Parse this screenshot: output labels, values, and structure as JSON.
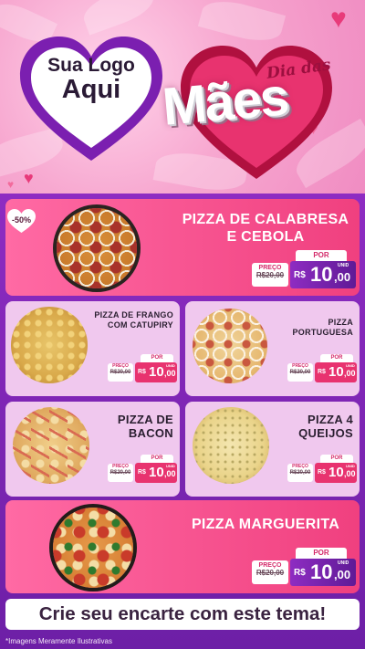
{
  "header": {
    "logo": {
      "line1": "Sua Logo",
      "line2": "Aqui"
    },
    "theme": {
      "small": "Dia das",
      "big": "Mães"
    },
    "colors": {
      "pink_bg": "#f7a8d0",
      "heart_red": "#e83a7a",
      "heart_purple": "#7b1fb0"
    }
  },
  "badge": {
    "text": "-50%",
    "icon": "heart-icon"
  },
  "products": [
    {
      "name": "PIZZA DE CALABRESA E CEBOLA",
      "price_label": "PREÇO",
      "old_price": "R$20,00",
      "por": "POR",
      "currency": "R$",
      "price_int": "10",
      "price_dec": ",00",
      "unit": "UNID"
    },
    {
      "name": "PIZZA DE FRANGO COM CATUPIRY",
      "price_label": "PREÇO",
      "old_price": "R$20,00",
      "por": "POR",
      "currency": "R$",
      "price_int": "10",
      "price_dec": ",00",
      "unit": "UNID"
    },
    {
      "name": "PIZZA PORTUGUESA",
      "price_label": "PREÇO",
      "old_price": "R$20,00",
      "por": "POR",
      "currency": "R$",
      "price_int": "10",
      "price_dec": ",00",
      "unit": "UNID"
    },
    {
      "name": "PIZZA DE BACON",
      "price_label": "PREÇO",
      "old_price": "R$20,00",
      "por": "POR",
      "currency": "R$",
      "price_int": "10",
      "price_dec": ",00",
      "unit": "UNID"
    },
    {
      "name": "PIZZA 4 QUEIJOS",
      "price_label": "PREÇO",
      "old_price": "R$20,00",
      "por": "POR",
      "currency": "R$",
      "price_int": "10",
      "price_dec": ",00",
      "unit": "UNID"
    },
    {
      "name": "PIZZA MARGUERITA",
      "price_label": "PREÇO",
      "old_price": "R$20,00",
      "por": "POR",
      "currency": "R$",
      "price_int": "10",
      "price_dec": ",00",
      "unit": "UNID"
    }
  ],
  "cta": "Crie seu encarte com este tema!",
  "disclaimer": "*Imagens Meramente Ilustrativas"
}
